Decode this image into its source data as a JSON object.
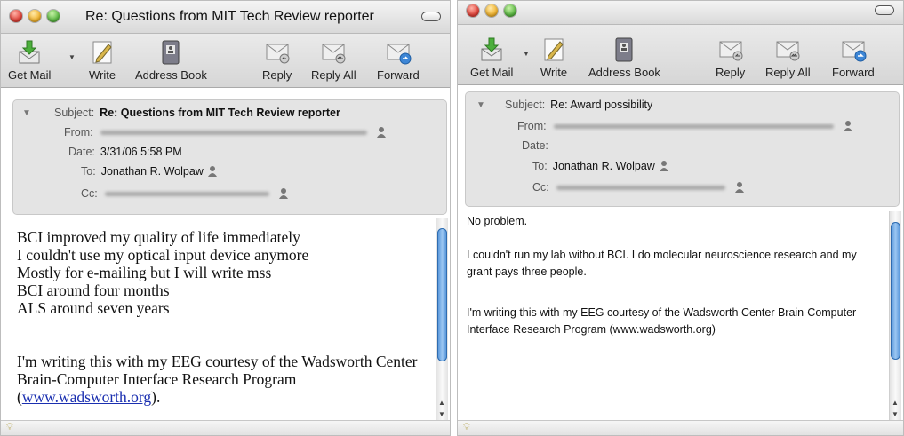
{
  "left": {
    "title": "Re: Questions from MIT Tech Review reporter",
    "toolbar": {
      "get_mail": "Get Mail",
      "write": "Write",
      "address_book": "Address Book",
      "reply": "Reply",
      "reply_all": "Reply All",
      "forward": "Forward"
    },
    "header": {
      "subject_label": "Subject:",
      "subject": "Re: Questions from MIT Tech Review reporter",
      "from_label": "From:",
      "date_label": "Date:",
      "date": "3/31/06 5:58 PM",
      "to_label": "To:",
      "to": "Jonathan R. Wolpaw",
      "cc_label": "Cc:"
    },
    "body": {
      "lines": [
        "BCI improved my quality of life immediately",
        "I couldn't use my optical input device anymore",
        "Mostly for e-mailing but I will write mss",
        "BCI around four months",
        "ALS around seven years"
      ],
      "para2_text": "I'm writing this with my EEG courtesy of the Wadsworth Center Brain-Computer Interface Research Program",
      "link_open": "(",
      "link": "www.wadsworth.org",
      "link_close": ")."
    }
  },
  "right": {
    "toolbar": {
      "get_mail": "Get Mail",
      "write": "Write",
      "address_book": "Address Book",
      "reply": "Reply",
      "reply_all": "Reply All",
      "forward": "Forward"
    },
    "header": {
      "subject_label": "Subject:",
      "subject": "Re: Award possibility",
      "from_label": "From:",
      "date_label": "Date:",
      "to_label": "To:",
      "to": "Jonathan R. Wolpaw",
      "cc_label": "Cc:"
    },
    "body": {
      "p1": "No problem.",
      "p2": "I couldn't run my lab without BCI. I do molecular neuroscience research and my grant pays three people.",
      "p3": "I'm writing this with my EEG courtesy of the Wadsworth Center Brain-Computer Interface Research Program (www.wadsworth.org)"
    }
  },
  "colors": {
    "link": "#1a2fb0",
    "scroll_thumb": "#4d8fd6",
    "traffic_red": "#e0433a",
    "traffic_yellow": "#f2b531",
    "traffic_green": "#5cb944"
  },
  "icons": [
    "get-mail-icon",
    "write-icon",
    "address-book-icon",
    "reply-icon",
    "reply-all-icon",
    "forward-icon",
    "person-icon",
    "disclosure-triangle-icon",
    "junk-bulb-icon"
  ]
}
